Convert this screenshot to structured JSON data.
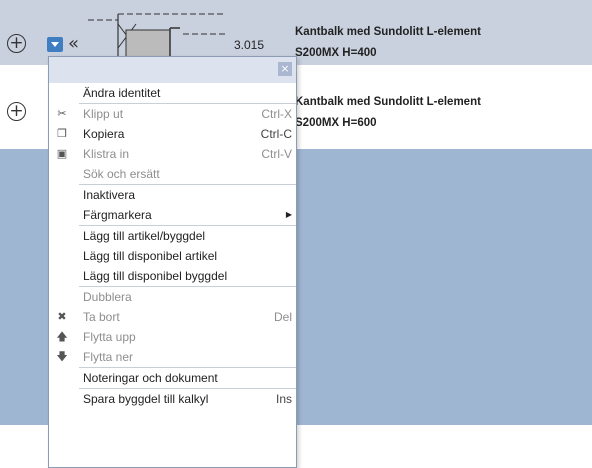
{
  "rows": [
    {
      "number": "3.015",
      "line1": "Kantbalk med Sundolitt L-element",
      "line2": "S200MX H=400"
    },
    {
      "number": "",
      "line1": "Kantbalk med Sundolitt L-element",
      "line2": "S200MX H=600"
    }
  ],
  "icons": {
    "expand": "plus-circle-icon",
    "dropdown": "dropdown-icon",
    "collapse": "double-chevron-left-icon"
  },
  "collapse_glyph": "«",
  "context_menu": {
    "close_glyph": "×",
    "items": [
      {
        "label": "Ändra identitet",
        "shortcut": "",
        "icon": "",
        "disabled": false
      },
      {
        "label": "Klipp ut",
        "shortcut": "Ctrl-X",
        "icon": "scissors",
        "disabled": true
      },
      {
        "label": "Kopiera",
        "shortcut": "Ctrl-C",
        "icon": "copy",
        "disabled": false
      },
      {
        "label": "Klistra in",
        "shortcut": "Ctrl-V",
        "icon": "paste",
        "disabled": true
      },
      {
        "label": "Sök och ersätt",
        "shortcut": "",
        "icon": "",
        "disabled": true
      },
      {
        "label": "Inaktivera",
        "shortcut": "",
        "icon": "",
        "disabled": false
      },
      {
        "label": "Färgmarkera",
        "shortcut": "",
        "icon": "",
        "disabled": false,
        "submenu": true
      },
      {
        "label": "Lägg till artikel/byggdel",
        "shortcut": "",
        "icon": "",
        "disabled": false
      },
      {
        "label": "Lägg till disponibel artikel",
        "shortcut": "",
        "icon": "",
        "disabled": false
      },
      {
        "label": "Lägg till disponibel byggdel",
        "shortcut": "",
        "icon": "",
        "disabled": false
      },
      {
        "label": "Dubblera",
        "shortcut": "",
        "icon": "",
        "disabled": true
      },
      {
        "label": "Ta bort",
        "shortcut": "Del",
        "icon": "close",
        "disabled": true
      },
      {
        "label": "Flytta upp",
        "shortcut": "",
        "icon": "arrow-up",
        "disabled": true
      },
      {
        "label": "Flytta ner",
        "shortcut": "",
        "icon": "arrow-down",
        "disabled": true
      },
      {
        "label": "Noteringar och dokument",
        "shortcut": "",
        "icon": "",
        "disabled": false
      },
      {
        "label": "Spara byggdel till kalkyl",
        "shortcut": "Ins",
        "icon": "",
        "disabled": false
      }
    ]
  }
}
